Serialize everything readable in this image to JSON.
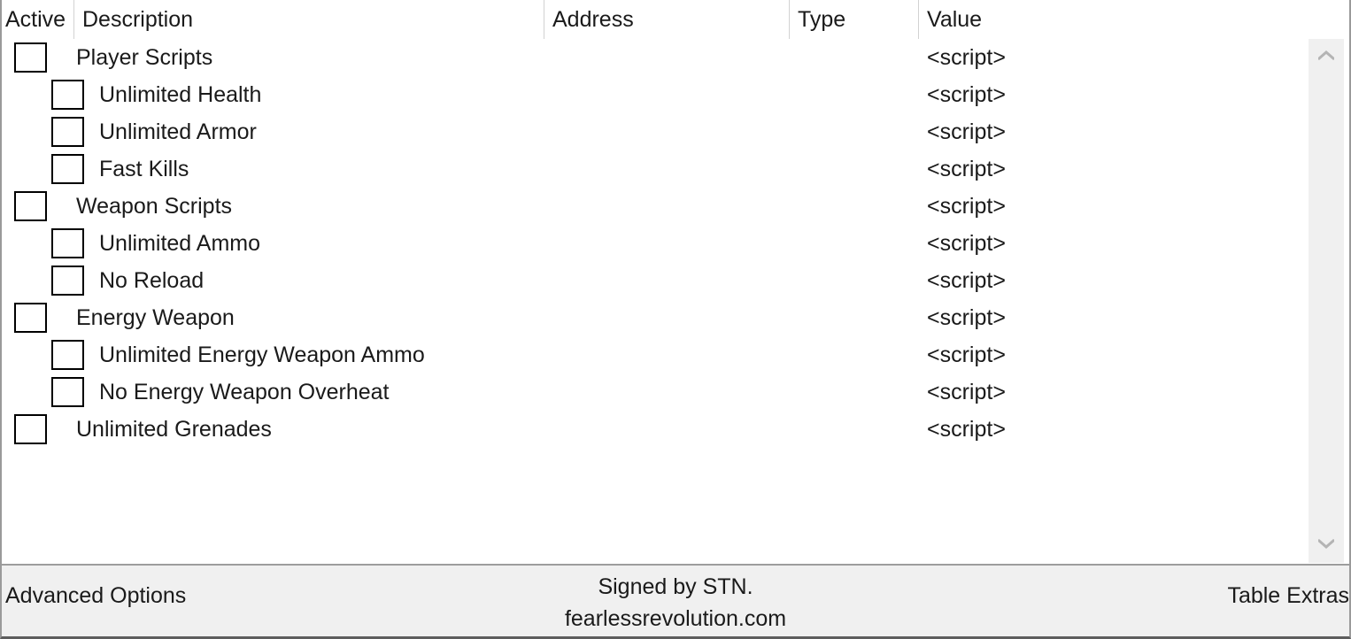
{
  "table": {
    "columns": [
      {
        "key": "active",
        "label": "Active"
      },
      {
        "key": "description",
        "label": "Description"
      },
      {
        "key": "address",
        "label": "Address"
      },
      {
        "key": "type",
        "label": "Type"
      },
      {
        "key": "value",
        "label": "Value"
      }
    ],
    "rows": [
      {
        "description": "Player Scripts",
        "address": "",
        "type": "",
        "value": "<script>",
        "level": 0,
        "checked": false
      },
      {
        "description": "Unlimited Health",
        "address": "",
        "type": "",
        "value": "<script>",
        "level": 1,
        "checked": false
      },
      {
        "description": "Unlimited Armor",
        "address": "",
        "type": "",
        "value": "<script>",
        "level": 1,
        "checked": false
      },
      {
        "description": "Fast Kills",
        "address": "",
        "type": "",
        "value": "<script>",
        "level": 1,
        "checked": false
      },
      {
        "description": "Weapon Scripts",
        "address": "",
        "type": "",
        "value": "<script>",
        "level": 0,
        "checked": false
      },
      {
        "description": "Unlimited Ammo",
        "address": "",
        "type": "",
        "value": "<script>",
        "level": 1,
        "checked": false
      },
      {
        "description": "No Reload",
        "address": "",
        "type": "",
        "value": "<script>",
        "level": 1,
        "checked": false
      },
      {
        "description": "Energy Weapon",
        "address": "",
        "type": "",
        "value": "<script>",
        "level": 0,
        "checked": false
      },
      {
        "description": "Unlimited Energy Weapon Ammo",
        "address": "",
        "type": "",
        "value": "<script>",
        "level": 1,
        "checked": false
      },
      {
        "description": "No Energy Weapon Overheat",
        "address": "",
        "type": "",
        "value": "<script>",
        "level": 1,
        "checked": false
      },
      {
        "description": "Unlimited Grenades",
        "address": "",
        "type": "",
        "value": "<script>",
        "level": 0,
        "checked": false
      }
    ]
  },
  "scrollbar": {
    "up_icon": "chevron-up-icon",
    "down_icon": "chevron-down-icon"
  },
  "statusbar": {
    "advanced_options": "Advanced Options",
    "signature_line1": "Signed by STN.",
    "signature_line2": "fearlessrevolution.com",
    "table_extras": "Table Extras"
  },
  "colors": {
    "background": "#ffffff",
    "text": "#1a1a1a",
    "statusbar_bg": "#f0f0f0",
    "divider": "#d2d2d2",
    "window_border": "#9a9a9a",
    "scrollbar_arrow": "#b4b4b4"
  }
}
